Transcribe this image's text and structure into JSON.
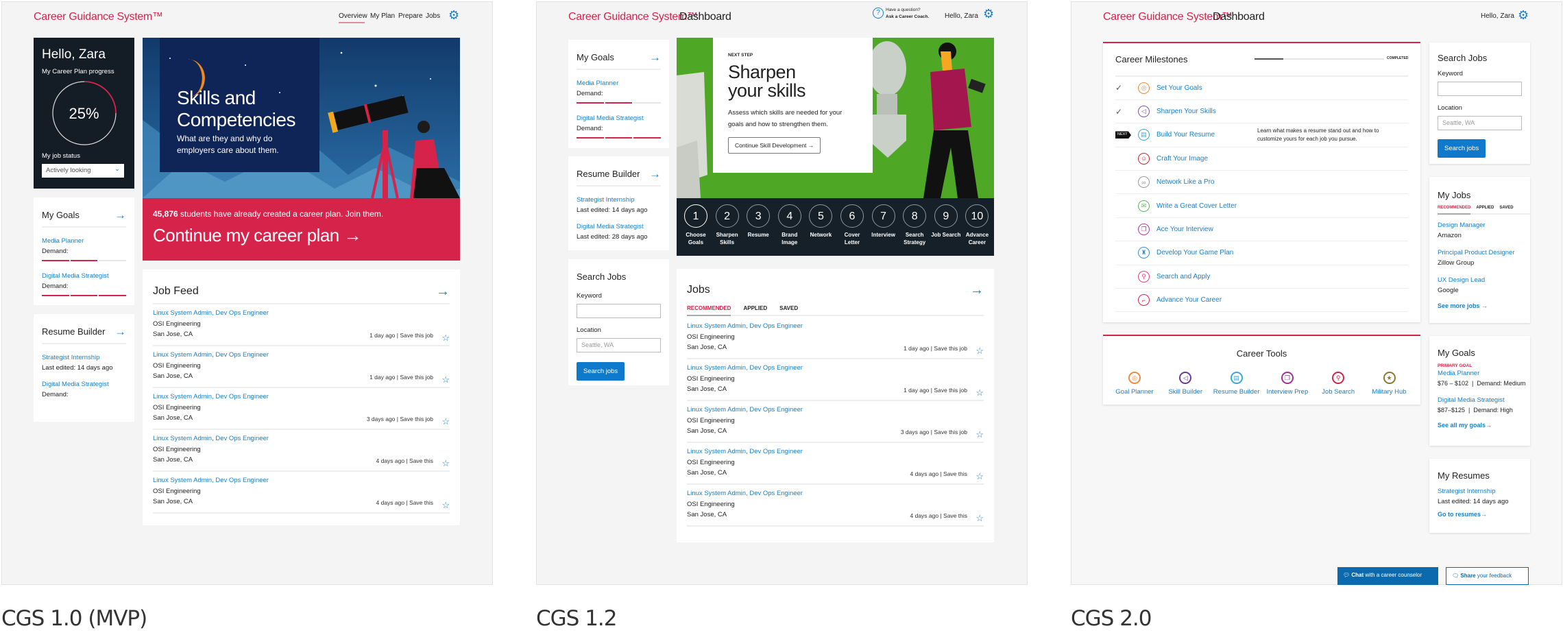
{
  "colors": {
    "brand": "#d6234a",
    "link": "#1a7fc9",
    "button": "#0f7acb",
    "dark_card": "#141c26",
    "hero_blue": "#1d4f86",
    "hero_green": "#4fa825"
  },
  "v1": {
    "brand": "Career Guidance System™",
    "nav": [
      "Overview",
      "My Plan",
      "Prepare",
      "Jobs"
    ],
    "nav_active": "Overview",
    "hello": "Hello, Zara",
    "progress_label": "My Career Plan progress",
    "progress_value": "25%",
    "progress_fraction": 0.25,
    "job_status_label": "My job status",
    "job_status": "Actively looking",
    "goals": {
      "title": "My Goals",
      "items": [
        {
          "title": "Media Planner",
          "demand_label": "Demand:",
          "demand_level": 2,
          "demand_max": 3
        },
        {
          "title": "Digital Media Strategist",
          "demand_label": "Demand:",
          "demand_level": 3,
          "demand_max": 3
        }
      ]
    },
    "resume": {
      "title": "Resume Builder",
      "items": [
        {
          "title": "Strategist Internship",
          "meta": "Last edited: 14 days ago"
        },
        {
          "title": "Digital Media Strategist",
          "meta": "Demand:"
        }
      ]
    },
    "hero": {
      "title_line1": "Skills and",
      "title_line2": "Competencies",
      "subtitle": "What are they and why do employers care about them."
    },
    "cta": {
      "count": "45,876",
      "text": " students have already created a career plan. Join them.",
      "button": "Continue my career plan"
    },
    "job_feed": {
      "title": "Job Feed",
      "jobs": [
        {
          "title": "Linux System Admin, Dev Ops Engineer",
          "company": "OSI Engineering",
          "location": "San Jose, CA",
          "meta": "1 day ago | Save this job"
        },
        {
          "title": "Linux System Admin, Dev Ops Engineer",
          "company": "OSI Engineering",
          "location": "San Jose, CA",
          "meta": "1 day ago | Save this job"
        },
        {
          "title": "Linux System Admin, Dev Ops Engineer",
          "company": "OSI Engineering",
          "location": "San Jose, CA",
          "meta": "3 days ago | Save this job"
        },
        {
          "title": "Linux System Admin, Dev Ops Engineer",
          "company": "OSI Engineering",
          "location": "San Jose, CA",
          "meta": "4 days ago | Save this"
        },
        {
          "title": "Linux System Admin, Dev Ops Engineer",
          "company": "OSI Engineering",
          "location": "San Jose, CA",
          "meta": "4 days ago | Save this"
        }
      ]
    },
    "caption": "CGS 1.0 (MVP)"
  },
  "v2": {
    "brand": "Career Guidance System™",
    "page": "Dashboard",
    "help_q": "Have a question?",
    "help_a": "Ask a Career Coach.",
    "hello": "Hello, Zara",
    "goals": {
      "title": "My Goals",
      "items": [
        {
          "title": "Media Planner",
          "demand_label": "Demand:",
          "demand_level": 2,
          "demand_max": 3
        },
        {
          "title": "Digital Media Strategist",
          "demand_label": "Demand:",
          "demand_level": 3,
          "demand_max": 3
        }
      ]
    },
    "resume": {
      "title": "Resume Builder",
      "items": [
        {
          "title": "Strategist Internship",
          "meta": "Last edited: 14 days ago"
        },
        {
          "title": "Digital Media Strategist",
          "meta": "Last edited: 28 days ago"
        }
      ]
    },
    "search": {
      "title": "Search Jobs",
      "keyword_label": "Keyword",
      "keyword_value": "",
      "location_label": "Location",
      "location_placeholder": "Seattle, WA",
      "button": "Search jobs"
    },
    "hero": {
      "eyebrow": "NEXT STEP",
      "title_line1": "Sharpen",
      "title_line2": "your skills",
      "body": "Assess which skills are needed for your goals and how to strengthen them.",
      "button": "Continue Skill Development"
    },
    "steps": [
      {
        "n": "1",
        "label": "Choose Goals"
      },
      {
        "n": "2",
        "label": "Sharpen Skills"
      },
      {
        "n": "3",
        "label": "Resume"
      },
      {
        "n": "4",
        "label": "Brand Image"
      },
      {
        "n": "5",
        "label": "Network"
      },
      {
        "n": "6",
        "label": "Cover Letter"
      },
      {
        "n": "7",
        "label": "Interview"
      },
      {
        "n": "8",
        "label": "Search Strategy"
      },
      {
        "n": "9",
        "label": "Job Search"
      },
      {
        "n": "10",
        "label": "Advance Career"
      }
    ],
    "jobs": {
      "title": "Jobs",
      "tabs": [
        "RECOMMENDED",
        "APPLIED",
        "SAVED"
      ],
      "active_tab": "RECOMMENDED",
      "jobs": [
        {
          "title": "Linux System Admin, Dev Ops Engineer",
          "company": "OSI Engineering",
          "location": "San Jose, CA",
          "meta": "1 day ago | Save this job"
        },
        {
          "title": "Linux System Admin, Dev Ops Engineer",
          "company": "OSI Engineering",
          "location": "San Jose, CA",
          "meta": "1 day ago | Save this job"
        },
        {
          "title": "Linux System Admin, Dev Ops Engineer",
          "company": "OSI Engineering",
          "location": "San Jose, CA",
          "meta": "3 days ago | Save this job"
        },
        {
          "title": "Linux System Admin, Dev Ops Engineer",
          "company": "OSI Engineering",
          "location": "San Jose, CA",
          "meta": "4 days ago | Save this"
        },
        {
          "title": "Linux System Admin, Dev Ops Engineer",
          "company": "OSI Engineering",
          "location": "San Jose, CA",
          "meta": "4 days ago | Save this"
        }
      ]
    },
    "caption": "CGS 1.2"
  },
  "v3": {
    "brand": "Career Guidance System™",
    "page": "Dashboard",
    "hello": "Hello, Zara",
    "milestones": {
      "title": "Career Milestones",
      "progress_label": "COMPLETED",
      "progress_fraction": 0.22,
      "items": [
        {
          "label": "Set Your Goals",
          "status": "done",
          "icon": "target-icon",
          "color": "#f08a3c"
        },
        {
          "label": "Sharpen Your Skills",
          "status": "done",
          "icon": "megaphone-icon",
          "color": "#8b4fb0"
        },
        {
          "label": "Build Your Resume",
          "status": "next",
          "icon": "document-icon",
          "color": "#3aa6dd",
          "next_label": "NEXT",
          "desc": "Learn what makes a resume stand out and how to customize yours for each job you pursue."
        },
        {
          "label": "Craft Your Image",
          "status": "todo",
          "icon": "person-icon",
          "color": "#c8262f"
        },
        {
          "label": "Network Like a Pro",
          "status": "todo",
          "icon": "network-icon",
          "color": "#999999"
        },
        {
          "label": "Write a Great Cover Letter",
          "status": "todo",
          "icon": "envelope-icon",
          "color": "#5cb85c"
        },
        {
          "label": "Ace Your Interview",
          "status": "todo",
          "icon": "chat-icon",
          "color": "#b03aa8"
        },
        {
          "label": "Develop Your Game Plan",
          "status": "todo",
          "icon": "chess-rook-icon",
          "color": "#3a8fd0"
        },
        {
          "label": "Search and Apply",
          "status": "todo",
          "icon": "search-person-icon",
          "color": "#e0457a"
        },
        {
          "label": "Advance Your Career",
          "status": "todo",
          "icon": "steps-icon",
          "color": "#d6234a"
        }
      ]
    },
    "tools": {
      "title": "Career Tools",
      "items": [
        {
          "label": "Goal Planner",
          "icon": "target-wrench-icon",
          "color": "#f08a3c"
        },
        {
          "label": "Skill Builder",
          "icon": "megaphone-wrench-icon",
          "color": "#6a3a9a"
        },
        {
          "label": "Resume Builder",
          "icon": "document-wrench-icon",
          "color": "#3aa6dd"
        },
        {
          "label": "Interview Prep",
          "icon": "chat-wrench-icon",
          "color": "#a0309a"
        },
        {
          "label": "Job Search",
          "icon": "search-wrench-icon",
          "color": "#d6234a"
        },
        {
          "label": "Military Hub",
          "icon": "star-medal-icon",
          "color": "#8a7a30"
        }
      ]
    },
    "search": {
      "title": "Search Jobs",
      "keyword_label": "Keyword",
      "keyword_value": "",
      "location_label": "Location",
      "location_placeholder": "Seattle, WA",
      "button": "Search jobs"
    },
    "my_jobs": {
      "title": "My Jobs",
      "tabs": [
        "RECOMMENDED",
        "APPLIED",
        "SAVED"
      ],
      "active_tab": "RECOMMENDED",
      "items": [
        {
          "title": "Design Manager",
          "company": "Amazon"
        },
        {
          "title": "Principal Product Designer",
          "company": "Zillow Group"
        },
        {
          "title": "UX Design Lead",
          "company": "Google"
        }
      ],
      "more": "See more jobs →"
    },
    "my_goals": {
      "title": "My Goals",
      "primary_label": "PRIMARY GOAL",
      "items": [
        {
          "title": "Media Planner",
          "detail": "$76 – $102  |  Demand: Medium"
        },
        {
          "title": "Digital Media Strategist",
          "detail": "$87–$125  |  Demand: High"
        }
      ],
      "more": "See all my goals→"
    },
    "my_resumes": {
      "title": "My Resumes",
      "items": [
        {
          "title": "Strategist Internship",
          "meta": "Last edited: 14 days ago"
        }
      ],
      "more": "Go to resumes→"
    },
    "chat": {
      "bold": "Chat",
      "rest": " with a career counselor"
    },
    "feedback": {
      "bold": "Share",
      "rest": " your feedback"
    },
    "caption": "CGS 2.0"
  }
}
